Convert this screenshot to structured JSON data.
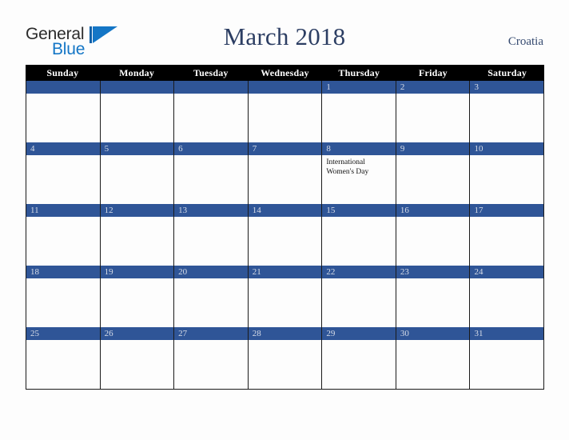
{
  "brand": {
    "name_part1": "General",
    "name_part2": "Blue",
    "mark_icon": "triangle-logo-icon",
    "color_dark": "#2b2b2b",
    "color_blue": "#1476c6"
  },
  "header": {
    "title": "March 2018",
    "region": "Croatia",
    "title_color": "#2c3e63",
    "region_color": "#34496f"
  },
  "calendar": {
    "accent_color": "#2f5597",
    "header_bg": "#000000",
    "header_text_color": "#ffffff",
    "weekdays": [
      "Sunday",
      "Monday",
      "Tuesday",
      "Wednesday",
      "Thursday",
      "Friday",
      "Saturday"
    ],
    "weeks": [
      [
        {
          "date": "",
          "events": []
        },
        {
          "date": "",
          "events": []
        },
        {
          "date": "",
          "events": []
        },
        {
          "date": "",
          "events": []
        },
        {
          "date": "1",
          "events": []
        },
        {
          "date": "2",
          "events": []
        },
        {
          "date": "3",
          "events": []
        }
      ],
      [
        {
          "date": "4",
          "events": []
        },
        {
          "date": "5",
          "events": []
        },
        {
          "date": "6",
          "events": []
        },
        {
          "date": "7",
          "events": []
        },
        {
          "date": "8",
          "events": [
            "International",
            "Women's Day"
          ]
        },
        {
          "date": "9",
          "events": []
        },
        {
          "date": "10",
          "events": []
        }
      ],
      [
        {
          "date": "11",
          "events": []
        },
        {
          "date": "12",
          "events": []
        },
        {
          "date": "13",
          "events": []
        },
        {
          "date": "14",
          "events": []
        },
        {
          "date": "15",
          "events": []
        },
        {
          "date": "16",
          "events": []
        },
        {
          "date": "17",
          "events": []
        }
      ],
      [
        {
          "date": "18",
          "events": []
        },
        {
          "date": "19",
          "events": []
        },
        {
          "date": "20",
          "events": []
        },
        {
          "date": "21",
          "events": []
        },
        {
          "date": "22",
          "events": []
        },
        {
          "date": "23",
          "events": []
        },
        {
          "date": "24",
          "events": []
        }
      ],
      [
        {
          "date": "25",
          "events": []
        },
        {
          "date": "26",
          "events": []
        },
        {
          "date": "27",
          "events": []
        },
        {
          "date": "28",
          "events": []
        },
        {
          "date": "29",
          "events": []
        },
        {
          "date": "30",
          "events": []
        },
        {
          "date": "31",
          "events": []
        }
      ]
    ]
  }
}
